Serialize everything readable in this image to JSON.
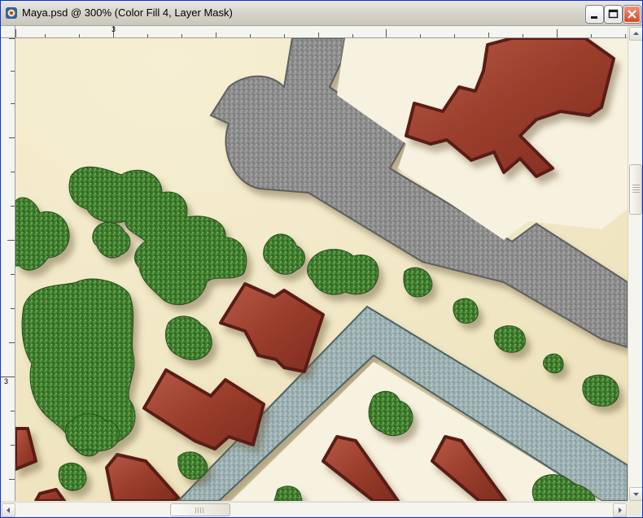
{
  "window": {
    "title": "Maya.psd @ 300% (Color Fill 4, Layer Mask)",
    "icons": {
      "app": "photoshop-document-icon",
      "minimize": "minimize-icon",
      "maximize": "maximize-icon",
      "close": "close-icon"
    }
  },
  "rulers": {
    "top_label": "3",
    "left_label": "3"
  },
  "canvas": {
    "content": "map-artwork",
    "colors": {
      "background": "#f3ecd2",
      "road": "#8e8e8e",
      "canal": "#9fb3b5",
      "building": "#9a3d2c",
      "building_outline": "#5a1a12",
      "tree": "#3f7f2f",
      "plot": "#f7f1df"
    }
  },
  "scrollbars": {
    "vertical": {
      "up": "scroll-up-arrow-icon",
      "down": "scroll-down-arrow-icon"
    },
    "horizontal": {
      "left": "scroll-left-arrow-icon",
      "right": "scroll-right-arrow-icon"
    }
  }
}
